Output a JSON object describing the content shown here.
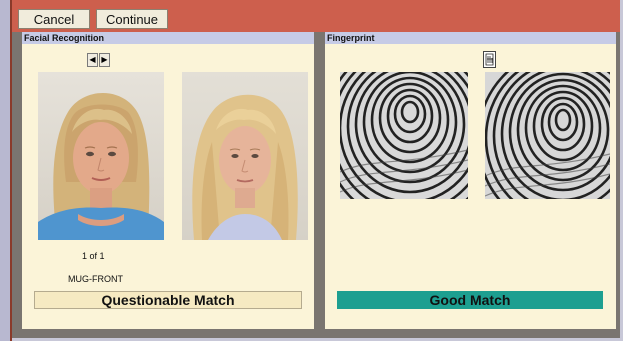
{
  "toolbar": {
    "cancel_label": "Cancel",
    "continue_label": "Continue"
  },
  "facial": {
    "header": "Facial Recognition",
    "counter": "1 of 1",
    "photo_type": "MUG-FRONT",
    "match_status": "Questionable Match",
    "nav_prev_icon": "arrow-left-icon",
    "nav_next_icon": "arrow-right-icon"
  },
  "fingerprint": {
    "header": "Fingerprint",
    "match_status": "Good Match",
    "toggle_icon": "fingerprint-compare-icon"
  },
  "colors": {
    "title_bar": "#cd5f4d",
    "panel_background": "#fbf4d8",
    "panel_header": "#c6cbe6",
    "questionable_match": "#f6eac2",
    "good_match": "#1d9f90"
  }
}
